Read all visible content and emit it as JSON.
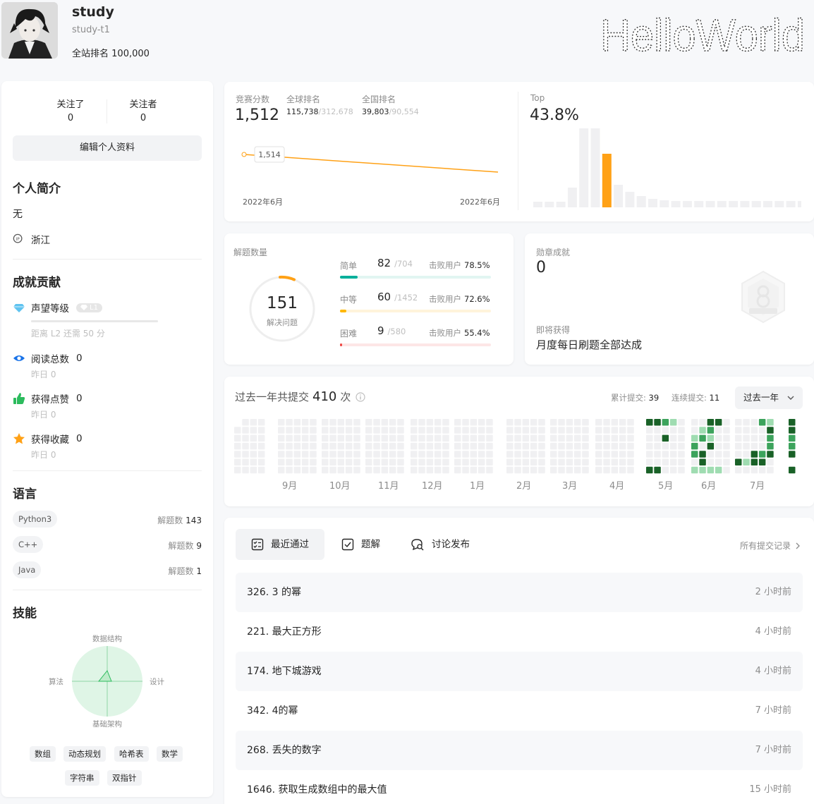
{
  "profile": {
    "username": "study",
    "user_id": "study-t1",
    "rank_label": "全站排名",
    "rank_value": "100,000",
    "banner_text": "HelloWorld"
  },
  "follow": {
    "following_label": "关注了",
    "following_count": "0",
    "followers_label": "关注者",
    "followers_count": "0",
    "edit_label": "编辑个人资料"
  },
  "bio": {
    "title": "个人简介",
    "text": "无",
    "location": "浙江"
  },
  "achievements": {
    "title": "成就贡献",
    "reputation_label": "声望等级",
    "reputation_level": "L1",
    "reputation_hint": "距离 L2 还需 50 分",
    "reads_label": "阅读总数",
    "reads_value": "0",
    "reads_sub": "昨日 0",
    "likes_label": "获得点赞",
    "likes_value": "0",
    "likes_sub": "昨日 0",
    "favs_label": "获得收藏",
    "favs_value": "0",
    "favs_sub": "昨日 0"
  },
  "languages": {
    "title": "语言",
    "count_label": "解题数",
    "items": [
      {
        "name": "Python3",
        "count": "143"
      },
      {
        "name": "C++",
        "count": "9"
      },
      {
        "name": "Java",
        "count": "1"
      }
    ]
  },
  "skills": {
    "title": "技能",
    "axes": {
      "top": "数据结构",
      "right": "设计",
      "bottom": "基础架构",
      "left": "算法"
    },
    "tags": [
      "数组",
      "动态规划",
      "哈希表",
      "数学",
      "字符串",
      "双指针"
    ]
  },
  "contest": {
    "score_label": "竞赛分数",
    "score": "1,512",
    "global_label": "全球排名",
    "global_rank": "115,738",
    "global_total": "/312,678",
    "national_label": "全国排名",
    "national_rank": "39,803",
    "national_total": "/90,554",
    "point_label": "1,514",
    "date_start": "2022年6月",
    "date_end": "2022年6月",
    "top_label": "Top",
    "top_value": "43.8%",
    "accent": "#ffa116"
  },
  "solved": {
    "title": "解题数量",
    "total": "151",
    "total_label": "解决问题",
    "beat_label": "击败用户",
    "easy": {
      "name": "简单",
      "count": "82",
      "total": "/704",
      "beat": "78.5%",
      "ratio": 0.116,
      "color": "#00af9b",
      "track": "#e1f5f2"
    },
    "medium": {
      "name": "中等",
      "count": "60",
      "total": "/1452",
      "beat": "72.6%",
      "ratio": 0.041,
      "color": "#ffb800",
      "track": "#fff4db"
    },
    "hard": {
      "name": "困难",
      "count": "9",
      "total": "/580",
      "beat": "55.4%",
      "ratio": 0.016,
      "color": "#ef4743",
      "track": "#fde6e6"
    }
  },
  "badge": {
    "title": "勋章成就",
    "count": "0",
    "upcoming_label": "即将获得",
    "upcoming_name": "月度每日刷题全部达成"
  },
  "heatmap": {
    "title_prefix": "过去一年共提交",
    "total": "410",
    "title_suffix": "次",
    "cumulative_label": "累计提交:",
    "cumulative_value": "39",
    "streak_label": "连续提交:",
    "streak_value": "11",
    "period": "过去一年",
    "months": [
      "9月",
      "10月",
      "11月",
      "12月",
      "1月",
      "2月",
      "3月",
      "4月",
      "5月",
      "6月",
      "7月"
    ]
  },
  "recent": {
    "tabs": [
      "最近通过",
      "题解",
      "讨论发布"
    ],
    "all_link": "所有提交记录",
    "items": [
      {
        "title": "326. 3 的幂",
        "time": "2 小时前"
      },
      {
        "title": "221. 最大正方形",
        "time": "4 小时前"
      },
      {
        "title": "174. 地下城游戏",
        "time": "4 小时前"
      },
      {
        "title": "342. 4的幂",
        "time": "7 小时前"
      },
      {
        "title": "268. 丢失的数字",
        "time": "7 小时前"
      },
      {
        "title": "1646. 获取生成数组中的最大值",
        "time": "15 小时前"
      }
    ]
  }
}
